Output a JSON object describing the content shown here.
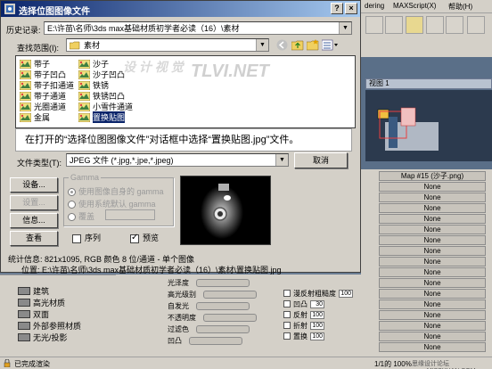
{
  "max": {
    "menu": [
      "dering",
      "MAXScript(X)",
      "帮助(H)"
    ],
    "viewport_label": "视图 1",
    "map_rows": [
      {
        "label": "Map #15 (沙子.png)"
      },
      {
        "label": "None"
      },
      {
        "label": "None"
      },
      {
        "label": "None"
      },
      {
        "label": "None"
      },
      {
        "label": "None"
      },
      {
        "label": "None"
      },
      {
        "label": "None"
      },
      {
        "label": "None"
      },
      {
        "label": "None"
      },
      {
        "label": "None"
      },
      {
        "label": "None"
      },
      {
        "label": "None"
      },
      {
        "label": "None"
      },
      {
        "label": "None"
      },
      {
        "label": "None"
      },
      {
        "label": "None"
      }
    ],
    "materials": [
      "建筑",
      "高光材质",
      "双面",
      "外部参照材质",
      "无光/投影"
    ],
    "properties": [
      {
        "label": "光泽度"
      },
      {
        "label": "高光级别"
      },
      {
        "label": "自发光"
      },
      {
        "label": "不透明度"
      },
      {
        "label": "过滤色"
      },
      {
        "label": "凹凸"
      }
    ],
    "right_props": [
      {
        "label": "漫反射粗糙度",
        "value": "100",
        "checked": true
      },
      {
        "label": "凹凸",
        "value": "30",
        "checked": true
      },
      {
        "label": "反射",
        "value": "100",
        "checked": false
      },
      {
        "label": "折射",
        "value": "100",
        "checked": false
      },
      {
        "label": "置换",
        "value": "100",
        "checked": false
      }
    ],
    "status_text": "已完成渲染",
    "status_right": "1/1的 100%",
    "watermark_bottom": "思缘设计论坛 www.MISSYUAN.COM"
  },
  "dialog": {
    "title": "选择位图图像文件",
    "history_label": "历史记录:",
    "history_value": "E:\\许苗\\名师\\3ds max基础材质初学者必读（16）\\素材",
    "lookin_label": "查找范围(I):",
    "lookin_value": "素材",
    "files": [
      {
        "name": "带子",
        "col": 0
      },
      {
        "name": "带子凹凸",
        "col": 0
      },
      {
        "name": "带子扣通道",
        "col": 0
      },
      {
        "name": "带子通道",
        "col": 0
      },
      {
        "name": "光圈通道",
        "col": 0
      },
      {
        "name": "金属",
        "col": 0
      },
      {
        "name": "沙子",
        "col": 1
      },
      {
        "name": "沙子凹凸",
        "col": 1
      },
      {
        "name": "铁锈",
        "col": 1
      },
      {
        "name": "铁锈凹凸",
        "col": 1
      },
      {
        "name": "小雪件通道",
        "col": 1
      },
      {
        "name": "置换贴图",
        "col": 1,
        "selected": true
      }
    ],
    "watermark": "TLVI.NET",
    "watermark_cn": "设 计 视 觉",
    "caption": "在打开的“选择位图图像文件”对话框中选择“置换贴图.jpg”文件。",
    "file_type_label": "文件类型(T):",
    "file_type_value": "JPEG 文件 (*.jpg,*.jpe,*.jpeg)",
    "cancel": "取消",
    "buttons": {
      "setup": "设备...",
      "settings": "设置...",
      "info": "信息...",
      "view": "查看"
    },
    "gamma": {
      "title": "Gamma",
      "opt1": "使用图像自身的 gamma",
      "opt2": "使用系统默认 gamma",
      "opt3": "覆盖"
    },
    "sequence_label": "序列",
    "preview_label": "预览",
    "stats": "统计信息: 821x1095, RGB 颜色 8 位/通道 - 单个图像",
    "location": "位置: E:\\许苗\\名师\\3ds max基础材质初学者必读（16）\\素材\\置换贴图.jpg"
  }
}
